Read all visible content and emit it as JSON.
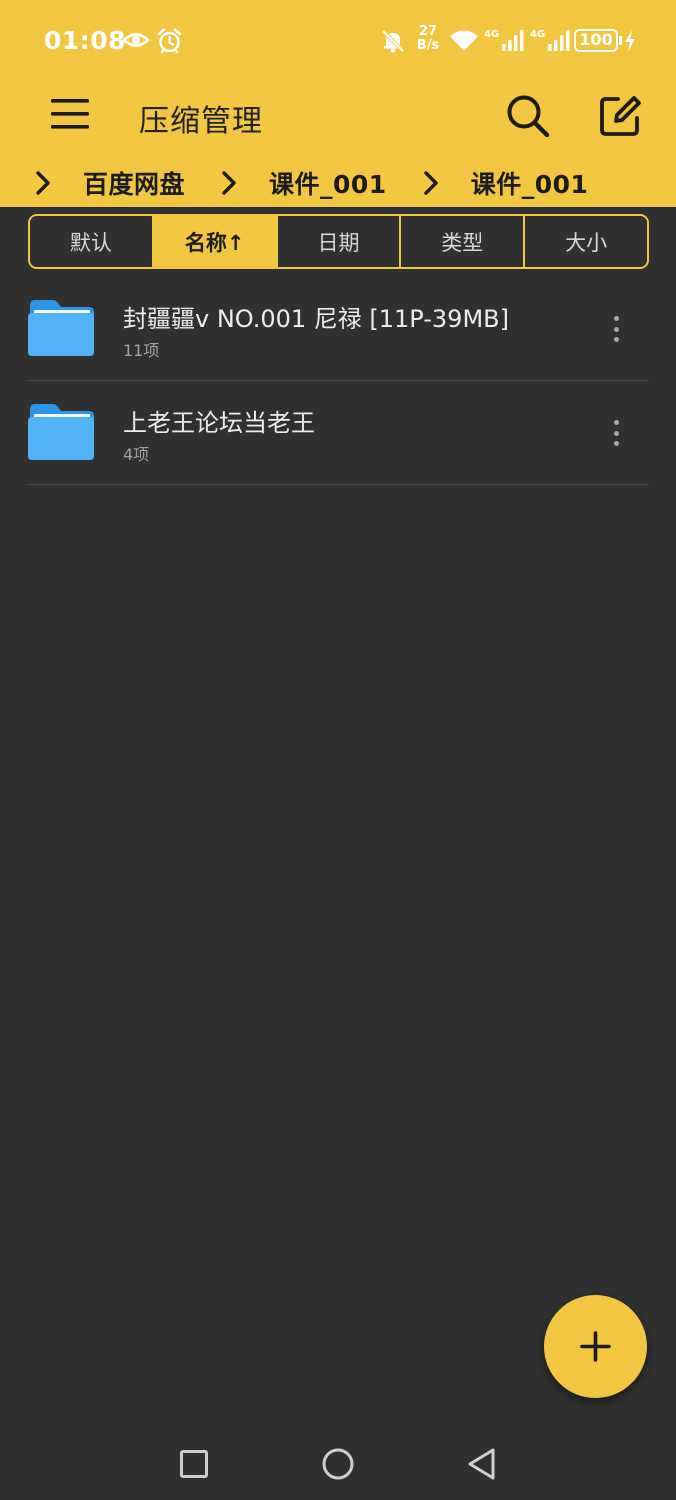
{
  "status_bar": {
    "time": "01:08",
    "net_speed_value": "27",
    "net_speed_unit": "B/s",
    "signal_1_label": "4G",
    "signal_2_label": "4G",
    "battery": "100",
    "icons": [
      "eye-icon",
      "alarm-icon",
      "mute-bell-icon",
      "wifi-icon",
      "cell-signal-icon",
      "cell-signal-icon",
      "battery-icon",
      "charging-bolt-icon"
    ]
  },
  "app_bar": {
    "title": "压缩管理",
    "icons": [
      "menu-icon",
      "search-icon",
      "edit-icon"
    ]
  },
  "breadcrumb": [
    "百度网盘",
    "课件_001",
    "课件_001"
  ],
  "sort_tabs": [
    {
      "label": "默认",
      "active": false
    },
    {
      "label": "名称↑",
      "active": true
    },
    {
      "label": "日期",
      "active": false
    },
    {
      "label": "类型",
      "active": false
    },
    {
      "label": "大小",
      "active": false
    }
  ],
  "files": [
    {
      "name": "封疆疆v NO.001 尼禄 [11P-39MB]",
      "count": "11项",
      "icon": "folder-icon"
    },
    {
      "name": "上老王论坛当老王",
      "count": "4项",
      "icon": "folder-icon"
    }
  ],
  "fab": {
    "icon": "plus-icon"
  },
  "nav_bar": {
    "icons": [
      "recents-square-icon",
      "home-circle-icon",
      "back-triangle-icon"
    ]
  },
  "colors": {
    "accent": "#F1C641",
    "background": "#303030",
    "folder": "#4FB3F5",
    "divider": "#474747"
  }
}
